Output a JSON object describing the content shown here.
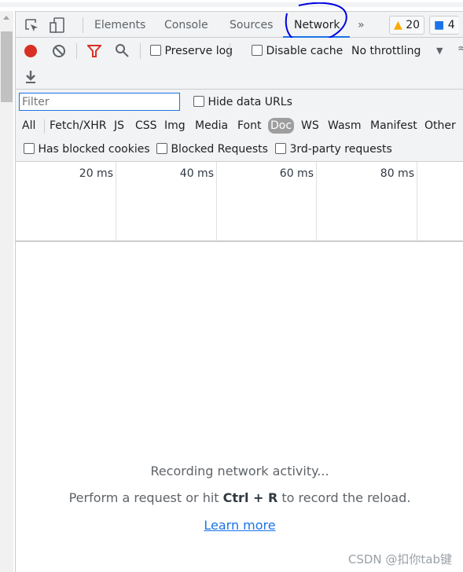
{
  "tabs": {
    "items": [
      "Elements",
      "Console",
      "Sources",
      "Network"
    ],
    "active": "Network",
    "more": "»",
    "warnings": "20",
    "messages": "4"
  },
  "toolbar": {
    "preserve_log": "Preserve log",
    "disable_cache": "Disable cache",
    "throttling": "No throttling"
  },
  "filter": {
    "placeholder": "Filter",
    "hide_data_urls": "Hide data URLs",
    "types": [
      "All",
      "Fetch/XHR",
      "JS",
      "CSS",
      "Img",
      "Media",
      "Font",
      "Doc",
      "WS",
      "Wasm",
      "Manifest",
      "Other"
    ],
    "active_type": "Doc",
    "has_blocked_cookies": "Has blocked cookies",
    "blocked_requests": "Blocked Requests",
    "third_party": "3rd-party requests"
  },
  "timeline": {
    "ticks": [
      "20 ms",
      "40 ms",
      "60 ms",
      "80 ms"
    ]
  },
  "empty": {
    "line1": "Recording network activity...",
    "line2_pre": "Perform a request or hit ",
    "line2_key": "Ctrl + R",
    "line2_post": " to record the reload.",
    "learn_more": "Learn more"
  },
  "watermark": "CSDN @扣你tab键",
  "colors": {
    "accent": "#1a73e8",
    "record": "#d93025",
    "annotation": "#0000e0"
  }
}
